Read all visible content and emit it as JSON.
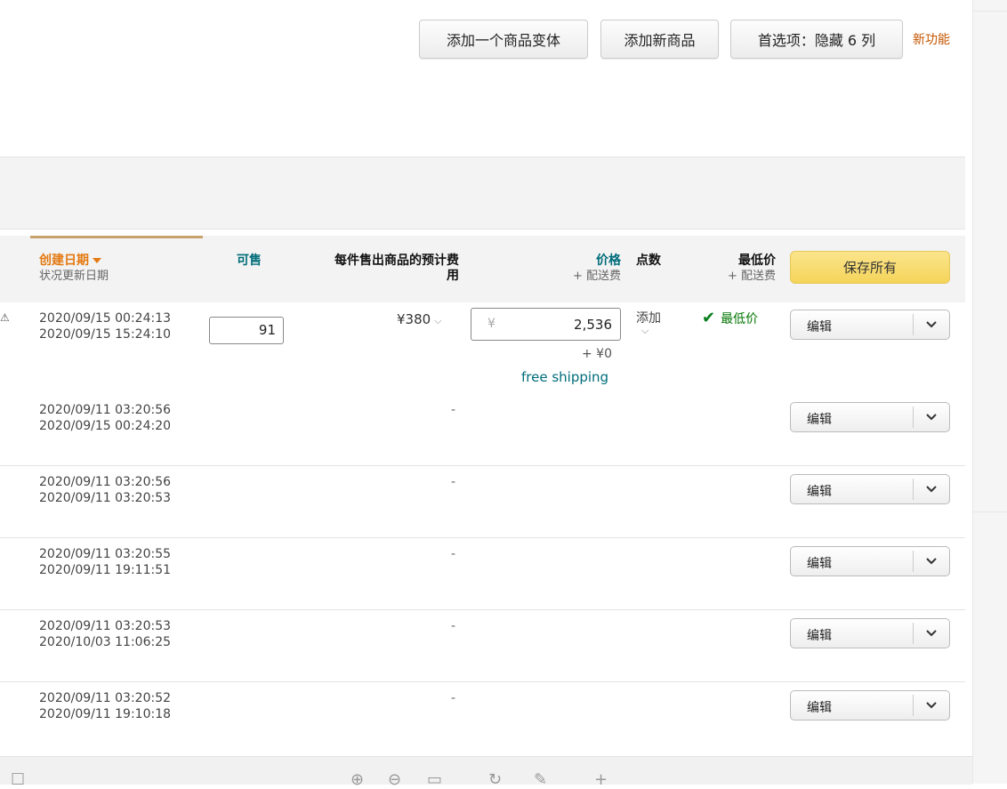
{
  "toolbar": {
    "add_variation": "添加一个商品变体",
    "add_product": "添加新商品",
    "preferences": "首选项：隐藏 6 列",
    "new_feature": "新功能"
  },
  "columns": {
    "created": "创建日期",
    "status_updated": "状况更新日期",
    "available": "可售",
    "fee_line1": "每件售出商品的预计费",
    "fee_line2": "用",
    "price": "价格",
    "price_sub": "+ 配送费",
    "points": "点数",
    "lowest": "最低价",
    "lowest_sub": "+ 配送费",
    "save_all": "保存所有"
  },
  "colors": {
    "accent_orange": "#e47911",
    "teal": "#006d7a",
    "save_yellow": "#f5d45a",
    "green": "#007600"
  },
  "rows": [
    {
      "created": "2020/09/15 00:24:13",
      "updated": "2020/09/15 15:24:10",
      "available": "91",
      "fee": "¥380",
      "price_currency": "¥",
      "price": "2,536",
      "shipping": "+ ¥0",
      "shipping_note": "free shipping",
      "points": "添加",
      "lowest": "最低价",
      "action": "编辑"
    },
    {
      "created": "2020/09/11 03:20:56",
      "updated": "2020/09/15 00:24:20",
      "fee": "-",
      "action": "编辑"
    },
    {
      "created": "2020/09/11 03:20:56",
      "updated": "2020/09/11 03:20:53",
      "fee": "-",
      "action": "编辑"
    },
    {
      "created": "2020/09/11 03:20:55",
      "updated": "2020/09/11 19:11:51",
      "fee": "-",
      "action": "编辑"
    },
    {
      "created": "2020/09/11 03:20:53",
      "updated": "2020/10/03 11:06:25",
      "fee": "-",
      "action": "编辑"
    },
    {
      "created": "2020/09/11 03:20:52",
      "updated": "2020/09/11 19:10:18",
      "fee": "-",
      "action": "编辑"
    }
  ],
  "icons": [
    "chevron-down-icon",
    "checkmark-icon",
    "sort-desc-icon",
    "warning-icon"
  ]
}
